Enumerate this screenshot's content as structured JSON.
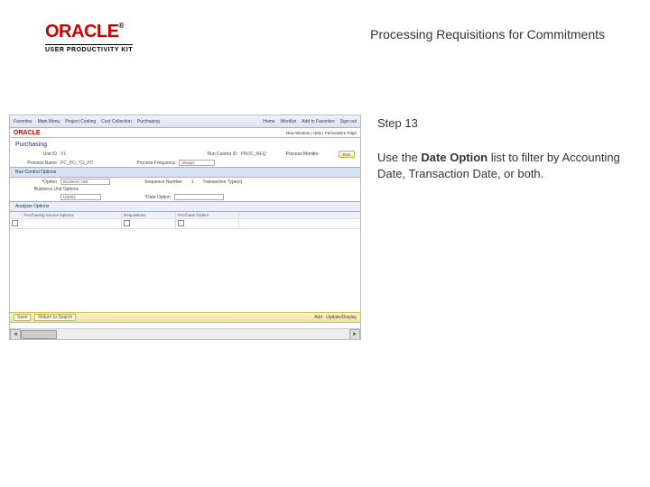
{
  "logo": {
    "brand": "ORACLE",
    "tm": "®",
    "subtitle": "USER PRODUCTIVITY KIT"
  },
  "page_title": "Processing Requisitions for Commitments",
  "instruction": {
    "step_label": "Step 13",
    "text_prefix": "Use the ",
    "bold": "Date Option",
    "text_suffix": " list to filter by Accounting Date, Transaction Date, or both."
  },
  "app": {
    "topnav": {
      "items": [
        "Favorites",
        "Main Menu",
        "Project Costing",
        "Cost Collection",
        "Purchasing"
      ],
      "right": [
        "Home",
        "Worklist",
        "Add to Favorites",
        "Sign out"
      ]
    },
    "bar2": {
      "brand": "ORACLE",
      "links": "New Window | Help | Personalize Page"
    },
    "module_title": "Purchasing",
    "filters": {
      "unit_label": "Unit ID",
      "unit_value": "V1",
      "run_control_label": "Run Control ID",
      "run_control_value": "PROC_REQ",
      "process_monitor": "Process Monitor",
      "run_btn": "Run",
      "process_name_label": "Process Name",
      "process_name_value": "PC_PO_TO_PC",
      "process_frequency_label": "Process Frequency",
      "process_frequency_value": "Always"
    },
    "run_control_hdr": "Run Control Options",
    "options": {
      "option_label": "*Option",
      "option_value": "Business Unit",
      "seq_label": "Sequence Number",
      "seq_value": "1",
      "trans_label": "Transaction Type(s)",
      "bu_label": "Business Unit Options",
      "bu_value": "US001",
      "date_opt_label": "*Date Option",
      "date_opt_value": ""
    },
    "grid": {
      "tabs": [
        "Analysis Options"
      ],
      "columns": [
        "",
        "Purchasing Source Options",
        "Requisitions",
        "Purchase Orders"
      ],
      "row": [
        "",
        "",
        "",
        ""
      ]
    },
    "footer": {
      "save": "Save",
      "main": "Return to Search",
      "add": "Add",
      "update": "Update/Display"
    }
  }
}
